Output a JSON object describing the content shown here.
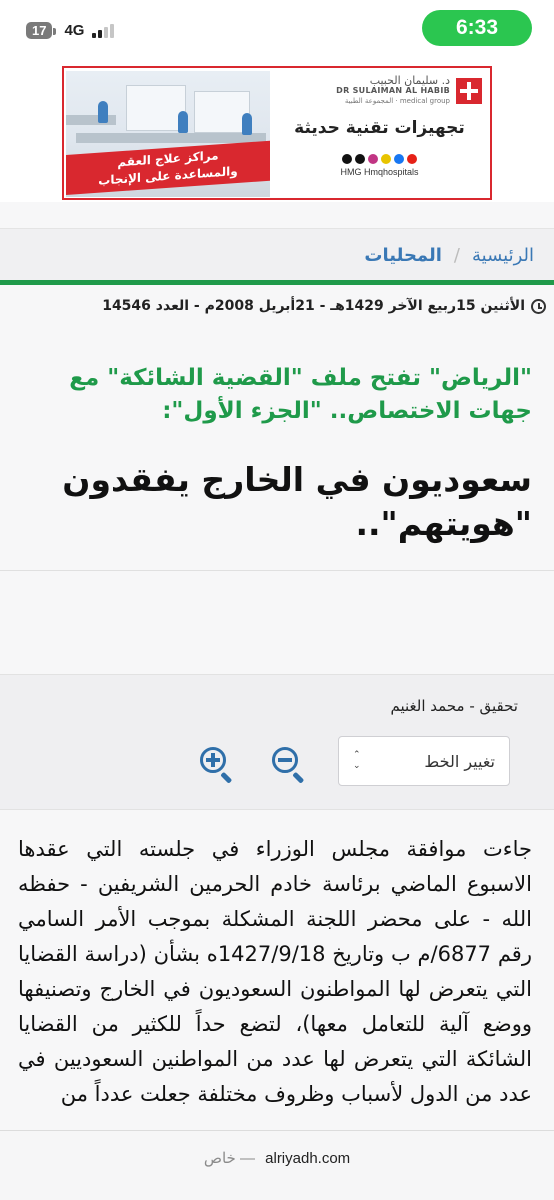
{
  "status_bar": {
    "time": "6:33",
    "battery": "17",
    "network": "4G"
  },
  "ad": {
    "logo_ar": "د. سليمان الحبيب",
    "logo_en": "DR SULAIMAN AL HABIB",
    "logo_sub": "المجموعة الطبية · medical group",
    "headline": "تجهيزات تقنية حديثة",
    "ribbon_line1": "مراكز علاج العقم",
    "ribbon_line2": "والمساعدة على الإنجاب",
    "handles": "HMG   Hmqhospitals",
    "brand_color": "#d9282f"
  },
  "breadcrumb": {
    "home": "الرئيسية",
    "separator": "/",
    "section": "المحليات"
  },
  "article": {
    "date_line": "الأثنين 15ربيع الآخر 1429هـ - 21أبريل 2008م - العدد 14546",
    "subtitle": "\"الرياض\" تفتح ملف \"القضية الشائكة\" مع جهات الاختصاص.. \"الجزء الأول\":",
    "title": "سعوديون في الخارج يفقدون \"هويتهم\"..",
    "author": "تحقيق - محمد الغنيم",
    "font_select_label": "تغيير الخط",
    "body": "جاءت موافقة مجلس الوزراء في جلسته التي عقدها الاسبوع الماضي برئاسة خادم الحرمين الشريفين - حفظه الله - على محضر اللجنة المشكلة بموجب الأمر السامي رقم 6877/م ب وتاريخ 1427/9/18ه بشأن (دراسة القضايا التي يتعرض لها المواطنون السعوديون في الخارج وتصنيفها ووضع آلية للتعامل معها)، لتضع حداً للكثير من القضايا الشائكة التي يتعرض لها عدد من المواطنين السعوديين في عدد من الدول لأسباب وظروف مختلفة جعلت عدداً من"
  },
  "browser": {
    "private_label": "خاص —",
    "url": "alriyadh.com"
  },
  "colors": {
    "accent_green": "#1f9a4a",
    "link_blue": "#3a78b5",
    "status_green": "#2bc650"
  }
}
